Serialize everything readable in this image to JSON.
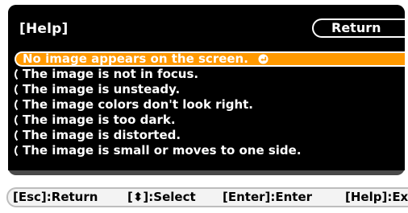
{
  "header": {
    "title": "[Help]",
    "return_label": "Return"
  },
  "menu": {
    "items": [
      {
        "label": "No image appears on the screen.",
        "selected": true,
        "icon": "enter-icon"
      },
      {
        "label": "The image is not in focus.",
        "selected": false
      },
      {
        "label": "The image is unsteady.",
        "selected": false
      },
      {
        "label": "The image colors don't look right.",
        "selected": false
      },
      {
        "label": "The image is too dark.",
        "selected": false
      },
      {
        "label": "The image is distorted.",
        "selected": false
      },
      {
        "label": "The image is small or moves to one side.",
        "selected": false
      }
    ]
  },
  "footer": {
    "esc": "[Esc]:Return",
    "select": "[⬍]:Select",
    "enter": "[Enter]:Enter",
    "help": "[Help]:Exit"
  },
  "colors": {
    "panel": "#000000",
    "selected": "#ff9900",
    "footer_bg": "#f3f3f3"
  }
}
